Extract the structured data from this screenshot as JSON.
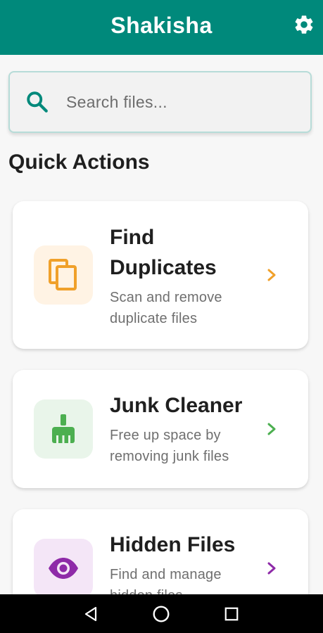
{
  "app": {
    "title": "Shakisha",
    "accent_color": "#00897b"
  },
  "header": {
    "settings_icon": "gear-icon"
  },
  "search": {
    "placeholder": "Search files...",
    "value": "",
    "icon": "search-icon"
  },
  "quick_actions": {
    "heading": "Quick Actions",
    "cards": [
      {
        "title": "Find Duplicates",
        "description": "Scan and remove duplicate files",
        "icon": "copy-icon",
        "color": "#f0a02a",
        "bg_color": "#fff3e4"
      },
      {
        "title": "Junk Cleaner",
        "description": "Free up space by removing junk files",
        "icon": "broom-icon",
        "color": "#4caf50",
        "bg_color": "#e9f5ea"
      },
      {
        "title": "Hidden Files",
        "description": "Find and manage hidden files",
        "icon": "eye-icon",
        "color": "#8e2aa8",
        "bg_color": "#f4e6f7"
      }
    ]
  },
  "system_nav": {
    "back_icon": "back-triangle-icon",
    "home_icon": "home-circle-icon",
    "recents_icon": "recents-square-icon"
  }
}
